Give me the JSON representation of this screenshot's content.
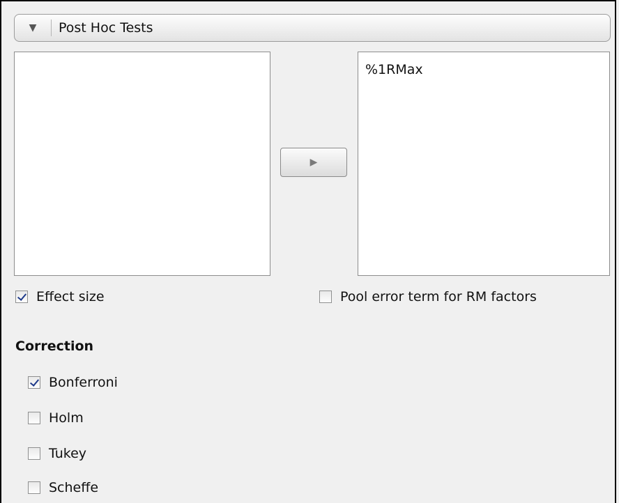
{
  "post_hoc": {
    "section_title": "Post Hoc Tests",
    "collapse_icon": "triangle-down-icon",
    "available_list": [],
    "selected_list": [
      "%1RMax"
    ],
    "move_icon": "triangle-right-icon"
  },
  "options": {
    "effect_size": {
      "label": "Effect size",
      "checked": true
    },
    "pool_error": {
      "label": "Pool error term for RM factors",
      "checked": false
    }
  },
  "correction": {
    "heading": "Correction",
    "items": [
      {
        "label": "Bonferroni",
        "checked": true
      },
      {
        "label": "Holm",
        "checked": false
      },
      {
        "label": "Tukey",
        "checked": false
      },
      {
        "label": "Scheffe",
        "checked": false
      }
    ]
  },
  "colors": {
    "check_mark": "#1e3a8a",
    "panel_bg": "#f0f0f0"
  }
}
